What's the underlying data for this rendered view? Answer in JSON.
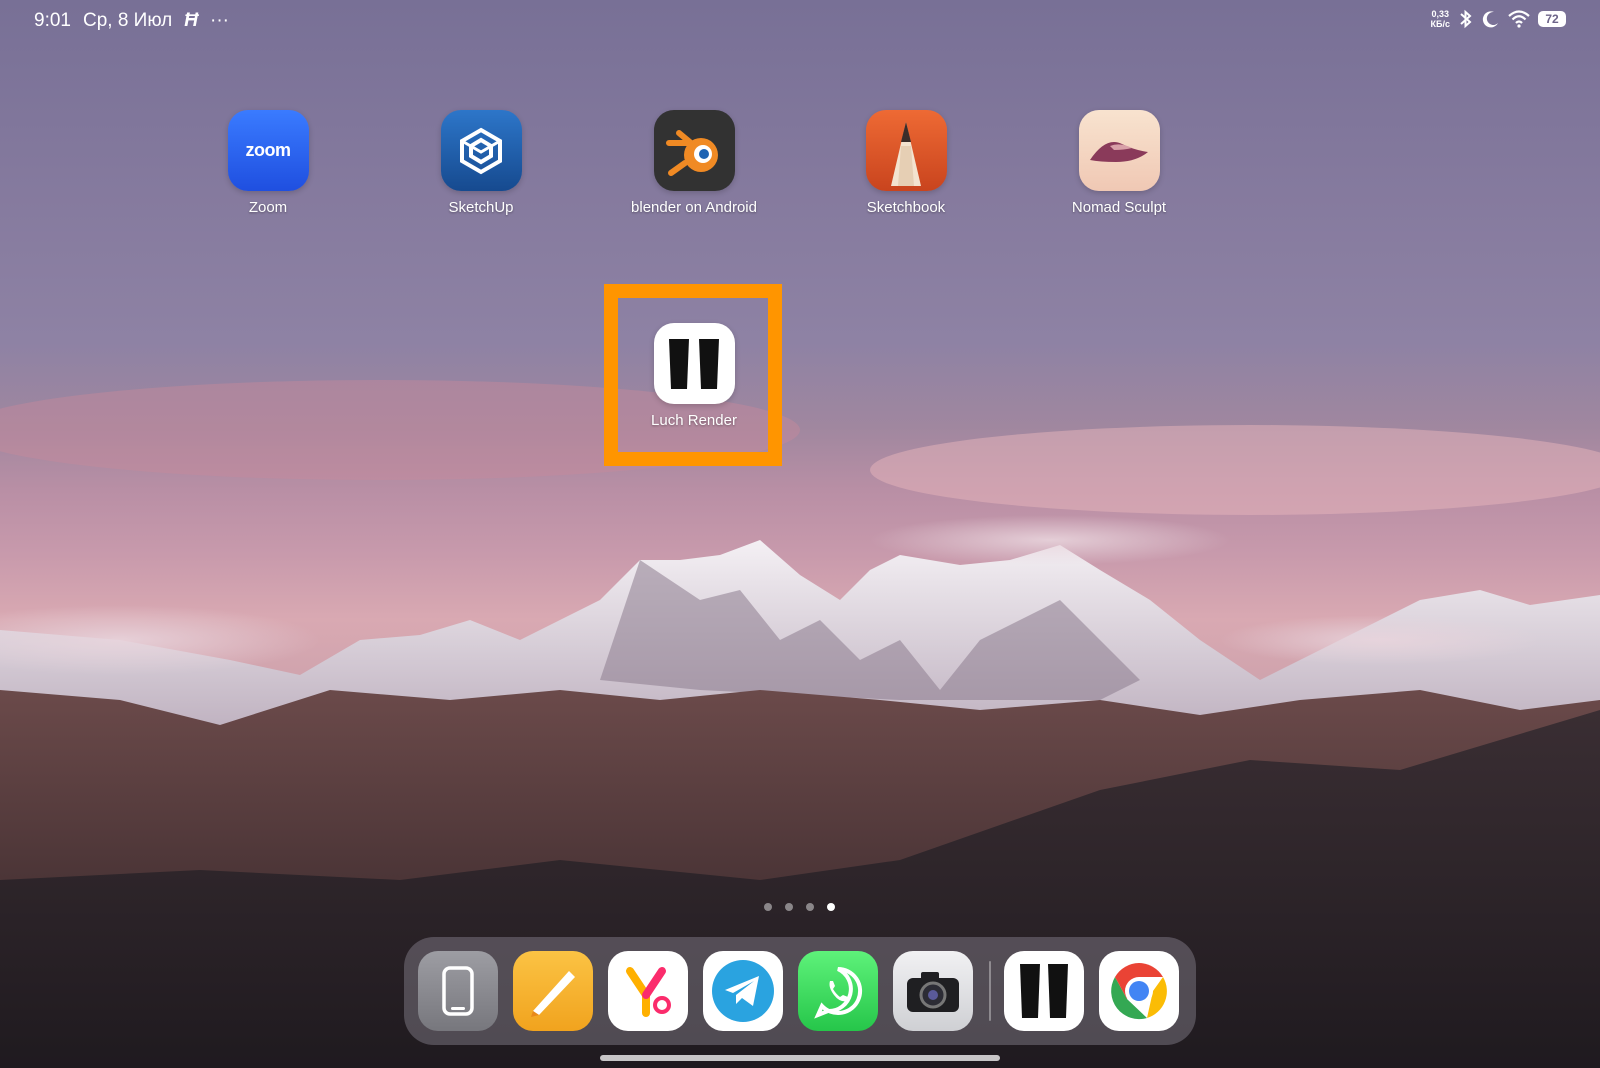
{
  "status_bar": {
    "time": "9:01",
    "date": "Ср, 8 Июл",
    "notification_glyph": "Ħ",
    "overflow": "···",
    "net_speed_value": "0,33",
    "net_speed_unit": "КБ/с",
    "battery": "72",
    "icons": [
      "bluetooth-icon",
      "moon-icon",
      "wifi-icon",
      "battery-icon"
    ]
  },
  "apps": [
    {
      "label": "Zoom",
      "icon": "zoom-icon",
      "color": "#2d6cf6"
    },
    {
      "label": "SketchUp",
      "icon": "sketchup-icon",
      "color": "#1f5fae"
    },
    {
      "label": "blender on Android",
      "icon": "blender-icon",
      "color": "#303030"
    },
    {
      "label": "Sketchbook",
      "icon": "sketchbook-icon",
      "color": "#e0562e"
    },
    {
      "label": "Nomad Sculpt",
      "icon": "nomad-sculpt-icon",
      "color": "#f3d4c0"
    },
    {
      "label": "Luch Render",
      "icon": "luch-render-icon",
      "color": "#ffffff"
    }
  ],
  "zoom_icon_text": "zoom",
  "highlight_color": "#ff9500",
  "page_indicator": {
    "count": 4,
    "active": 4
  },
  "dock": [
    "phone-icon",
    "notes-icon",
    "yandex-icon",
    "telegram-icon",
    "whatsapp-icon",
    "camera-icon",
    "luch-render-icon",
    "chrome-icon"
  ]
}
